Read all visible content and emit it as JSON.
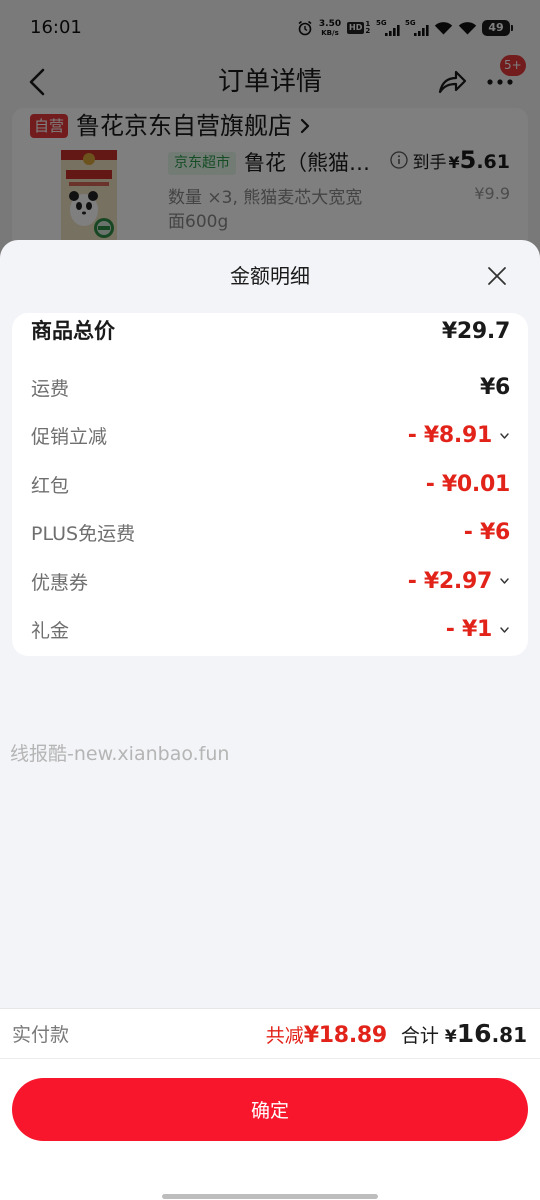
{
  "status_bar": {
    "time": "16:01",
    "net_speed_value": "3.50",
    "net_speed_unit": "KB/s",
    "hd_label": "HD",
    "hd_sim_top": "1",
    "hd_sim_bottom": "2",
    "sim1_network": "5G",
    "sim2_network": "5G",
    "battery": "49"
  },
  "header": {
    "title": "订单详情",
    "more_badge": "5+"
  },
  "store": {
    "badge": "自营",
    "name": "鲁花京东自营旗舰店"
  },
  "product": {
    "tag": "京东超市",
    "name": "鲁花（熊猫…",
    "final_price_label": "到手",
    "final_price_currency": "¥",
    "final_price_int": "5",
    "final_price_dec": ".61",
    "original_price": "¥9.9",
    "spec": "数量 ×3, 熊猫麦芯大宽宽面600g"
  },
  "sheet": {
    "title": "金额明细",
    "rows": [
      {
        "label": "商品总价",
        "value": "¥29.7",
        "is_total": true,
        "is_discount": false,
        "expandable": false
      },
      {
        "label": "运费",
        "value": "¥6",
        "is_total": false,
        "is_discount": false,
        "expandable": false
      },
      {
        "label": "促销立减",
        "value": "- ¥8.91",
        "is_total": false,
        "is_discount": true,
        "expandable": true
      },
      {
        "label": "红包",
        "value": "- ¥0.01",
        "is_total": false,
        "is_discount": true,
        "expandable": false
      },
      {
        "label": "PLUS免运费",
        "value": "- ¥6",
        "is_total": false,
        "is_discount": true,
        "expandable": false
      },
      {
        "label": "优惠券",
        "value": "- ¥2.97",
        "is_total": false,
        "is_discount": true,
        "expandable": true
      },
      {
        "label": "礼金",
        "value": "- ¥1",
        "is_total": false,
        "is_discount": true,
        "expandable": true
      }
    ],
    "watermark": "线报酷-new.xianbao.fun"
  },
  "footer": {
    "paid_label": "实付款",
    "reduce_label": "共减",
    "reduce_amount": "¥18.89",
    "total_label": "合计",
    "total_currency": "¥",
    "total_int": "16",
    "total_dec": ".81"
  },
  "confirm_button": {
    "label": "确定"
  },
  "icons": {
    "header_left": "back-arrow-icon",
    "header_share": "share-icon",
    "header_more": "more-dots-icon",
    "store_link": "chevron-right-icon",
    "price_info": "info-icon",
    "sheet_close": "close-icon",
    "row_expand": "chevron-down-icon"
  },
  "colors": {
    "brand_red": "#e2231a",
    "button_red": "#f7162c",
    "badge_red": "#e4393c",
    "tag_green": "#2a9d4b",
    "tag_green_bg": "#e6f6ea",
    "sheet_bg": "#f3f4f8",
    "overlay": "rgba(0,0,0,0.5)"
  }
}
